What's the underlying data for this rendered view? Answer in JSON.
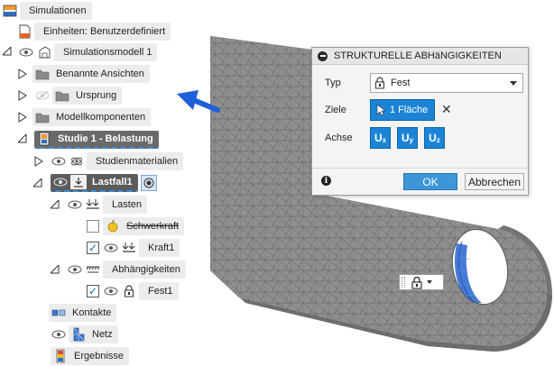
{
  "browser": {
    "root": {
      "label": "Simulationen",
      "icon": "simulation-icon"
    },
    "units": {
      "label": "Einheiten: Benutzerdefiniert",
      "icon": "document-icon"
    },
    "model": {
      "label": "Simulationsmodell 1",
      "icon": "model-icon"
    },
    "model_children": [
      {
        "label": "Benannte Ansichten",
        "icon": "folder-icon"
      },
      {
        "label": "Ursprung",
        "icon": "folder-icon"
      },
      {
        "label": "Modellkomponenten",
        "icon": "folder-icon"
      }
    ],
    "study": {
      "label": "Studie 1 - Belastung",
      "icon": "study-icon"
    },
    "materials": {
      "label": "Studienmaterialien",
      "icon": "materials-icon"
    },
    "loadcase": {
      "label": "Lastfall1",
      "icon": "loadcase-icon"
    },
    "loads": {
      "label": "Lasten",
      "icon": "loads-icon"
    },
    "gravity": {
      "label": "Schwerkraft",
      "icon": "gravity-icon",
      "checked": false
    },
    "force": {
      "label": "Kraft1",
      "icon": "force-icon",
      "checked": true
    },
    "constraints": {
      "label": "Abhängigkeiten",
      "icon": "constraints-icon"
    },
    "fixed": {
      "label": "Fest1",
      "icon": "lock-icon",
      "checked": true
    },
    "contacts": {
      "label": "Kontakte",
      "icon": "contacts-icon"
    },
    "mesh": {
      "label": "Netz",
      "icon": "mesh-icon"
    },
    "results": {
      "label": "Ergebnisse",
      "icon": "results-icon"
    }
  },
  "dialog": {
    "title": "STRUKTURELLE ABHäNGIGKEITEN",
    "type_label": "Typ",
    "type_value": "Fest",
    "targets_label": "Ziele",
    "targets_value": "1 Fläche",
    "axis_label": "Achse",
    "axes": [
      {
        "main": "U",
        "sub": "x"
      },
      {
        "main": "U",
        "sub": "y"
      },
      {
        "main": "U",
        "sub": "z"
      }
    ],
    "ok_label": "OK",
    "cancel_label": "Abbrechen"
  },
  "colors": {
    "accent": "#1c84d6",
    "mesh_fill": "#8c8c8c",
    "mesh_lines": "#5a5a5a",
    "selected_face": "#3a78d8",
    "arrow": "#1f5fd8"
  }
}
